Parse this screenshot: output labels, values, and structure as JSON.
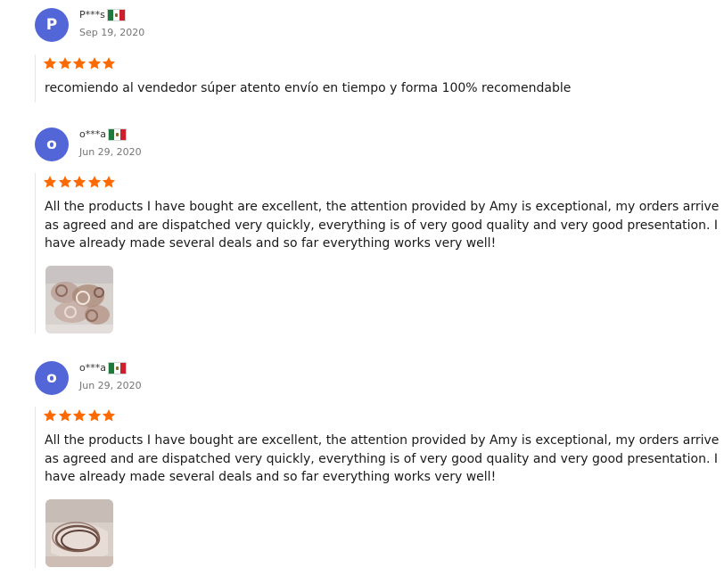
{
  "colors": {
    "avatar_bg": "#5266d8",
    "star": "#ff6a00",
    "date_text": "#757575"
  },
  "reviews": [
    {
      "avatar_letter": "P",
      "username": "P***s",
      "country_flag": "mexico-flag-icon",
      "date": "Sep 19, 2020",
      "rating": 5,
      "text_lines": [
        "recomiendo al vendedor súper atento envío en tiempo y forma 100% recomendable"
      ],
      "has_photo": false
    },
    {
      "avatar_letter": "o",
      "username": "o***a",
      "country_flag": "mexico-flag-icon",
      "date": "Jun 29, 2020",
      "rating": 5,
      "text_lines": [
        "All the products I have bought are excellent, the attention provided by Amy is exceptional, my orders arrive",
        "as agreed and are dispatched very quickly, everything is of very good quality and very good presentation. I",
        "have already made several deals and so far everything works very well!"
      ],
      "has_photo": true,
      "photo_icon": "jewelry-photo"
    },
    {
      "avatar_letter": "o",
      "username": "o***a",
      "country_flag": "mexico-flag-icon",
      "date": "Jun 29, 2020",
      "rating": 5,
      "text_lines": [
        "All the products I have bought are excellent, the attention provided by Amy is exceptional, my orders arrive",
        "as agreed and are dispatched very quickly, everything is of very good quality and very good presentation. I",
        "have already made several deals and so far everything works very well!"
      ],
      "has_photo": true,
      "photo_icon": "bracelet-photo"
    }
  ]
}
